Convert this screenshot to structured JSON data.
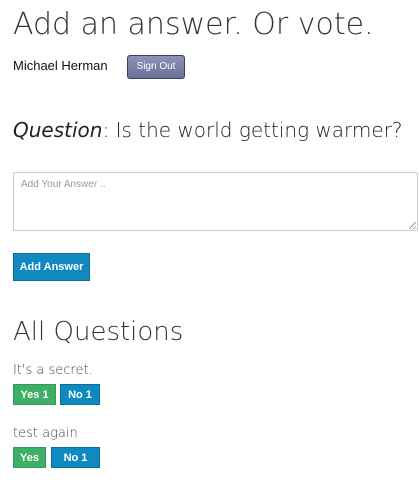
{
  "header": {
    "title": "Add an answer. Or vote.",
    "user_name": "Michael Herman",
    "sign_out_label": "Sign Out"
  },
  "question": {
    "label": "Question",
    "separator": ": ",
    "text": "Is the world getting warmer?"
  },
  "answer_form": {
    "placeholder": "Add Your Answer ..",
    "value": "",
    "submit_label": "Add Answer"
  },
  "questions_section": {
    "title": "All Questions",
    "items": [
      {
        "text": "It's a secret.",
        "yes_label": "Yes 1",
        "no_label": "No 1"
      },
      {
        "text": "test again",
        "yes_label": "Yes",
        "no_label": "No 1"
      }
    ]
  },
  "colors": {
    "primary_blue": "#0e8ac0",
    "vote_green": "#3eaf67",
    "signout_purple": "#7a7fa6"
  },
  "icons": {
    "textarea_resize": "resize-grip-icon"
  }
}
